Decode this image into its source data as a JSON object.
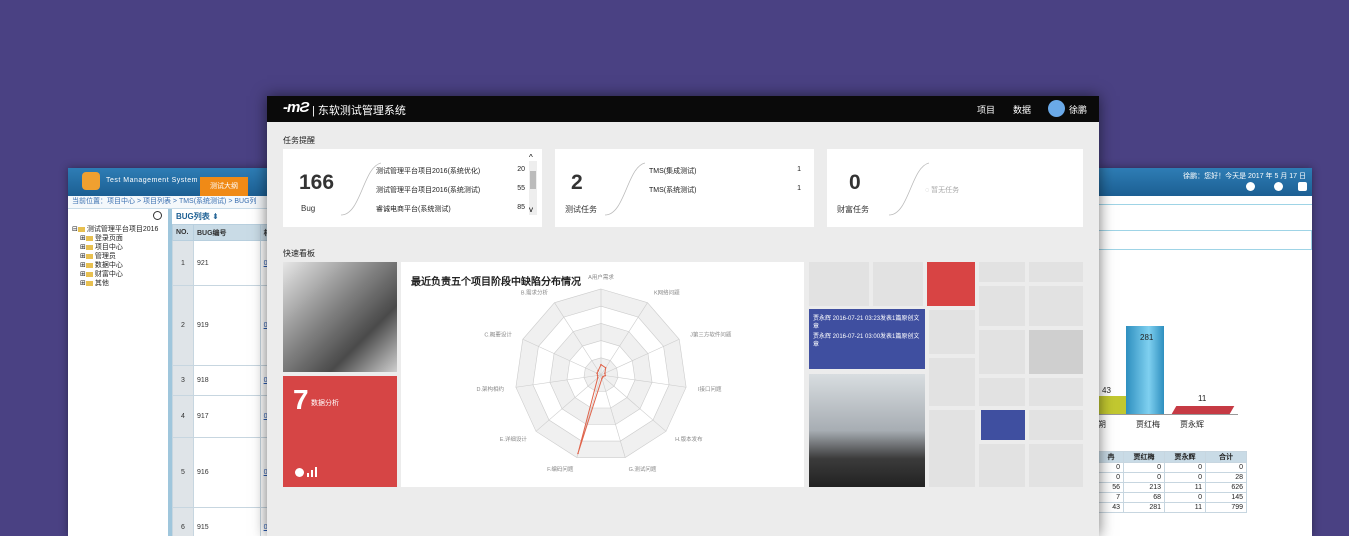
{
  "left_window": {
    "brand": "Test Management System",
    "tab": "测试大纲",
    "breadcrumb": "当前位置：项目中心 > 项目列表 > TMS(系统测试) > BUG列",
    "tree_root": "测试管理平台项目2016",
    "tree_items": [
      "登录页面",
      "项目中心",
      "管理员",
      "数据中心",
      "财富中心",
      "其他"
    ],
    "list_title": "BUG列表",
    "columns": [
      "NO.",
      "BUG编号",
      "相"
    ],
    "rows": [
      {
        "no": "1",
        "id": "921",
        "link": "03-0 1"
      },
      {
        "no": "2",
        "id": "919",
        "link": "02-0"
      },
      {
        "no": "3",
        "id": "918",
        "link": "02-0 2"
      },
      {
        "no": "4",
        "id": "917",
        "link": "03-0 2-01"
      },
      {
        "no": "5",
        "id": "916",
        "link": "02-0"
      },
      {
        "no": "6",
        "id": "915",
        "link": "02-0 1"
      }
    ]
  },
  "right_window": {
    "greeting": "徐鹏：您好！今天是 2017 年 5 月 17 日",
    "bar_labels": [
      "贾红梅",
      "贾永辉"
    ],
    "bar_values": [
      "281",
      "43",
      "11"
    ],
    "partial_label": "朔",
    "table_headers": [
      "冉",
      "贾红梅",
      "贾永辉",
      "合计"
    ],
    "table_rows": [
      [
        "0",
        "0",
        "0",
        "0"
      ],
      [
        "0",
        "0",
        "0",
        "28"
      ],
      [
        "56",
        "213",
        "11",
        "626"
      ],
      [
        "7",
        "68",
        "0",
        "145"
      ],
      [
        "43",
        "281",
        "11",
        "799"
      ]
    ]
  },
  "center_window": {
    "logo_glyph": "-mƧ",
    "app_title": "| 东软测试管理系统",
    "nav": {
      "project": "项目",
      "data": "数据",
      "user": "徐鹏"
    },
    "section_tasks": "任务提醒",
    "section_board": "快速看板",
    "bug_card": {
      "count": "166",
      "label": "Bug",
      "items": [
        {
          "name": "测试管理平台项目2016(系统优化)",
          "value": "20"
        },
        {
          "name": "测试管理平台项目2016(系统测试)",
          "value": "55"
        },
        {
          "name": "睿诚电商平台(系统测试)",
          "value": "85"
        }
      ]
    },
    "test_card": {
      "count": "2",
      "label": "测试任务",
      "items": [
        {
          "name": "TMS(集成测试)",
          "value": "1"
        },
        {
          "name": "TMS(系统测试)",
          "value": "1"
        }
      ]
    },
    "wealth_card": {
      "count": "0",
      "label": "财富任务",
      "empty": "暂无任务"
    },
    "red_tile": {
      "number": "7",
      "label": "数据分析"
    },
    "news": [
      "贾永辉 2016-07-21 03:23发表1篇原创文章",
      "贾永辉 2016-07-21 03:00发表1篇原创文章"
    ]
  },
  "chart_data": {
    "type": "radar",
    "title": "最近负责五个项目阶段中缺陷分布情况",
    "axes": [
      "A用户需求",
      "K网络问题",
      "J第三方软件问题",
      "I接口问题",
      "H.版本发布",
      "G.测试问题",
      "F.编码问题",
      "E.详细设计",
      "D.架构相约",
      "C.概要设计",
      "B.需求分析"
    ],
    "series": [
      {
        "values": [
          0.12,
          0.1,
          0.05,
          0.05,
          0.03,
          0.04,
          0.95,
          0.05,
          0.04,
          0.05,
          0.06
        ]
      }
    ],
    "rings": 5,
    "colors": {
      "series": "#e0634a",
      "grid_fill": "#f0f0f0",
      "grid_line": "#cccccc"
    }
  }
}
